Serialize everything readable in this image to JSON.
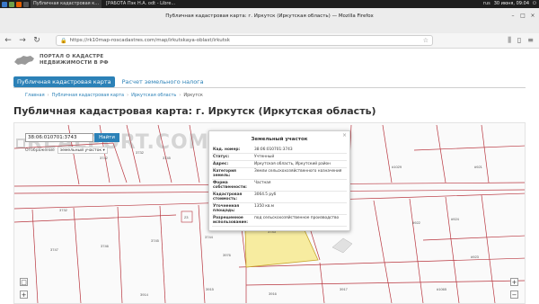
{
  "taskbar": {
    "tasks": [
      "Публичная кадастровая к...",
      "[РАБОТА Пэк Н.А. odt - Libre..."
    ],
    "clock": "30 июня, 09:04",
    "keyboard": "rus"
  },
  "browser": {
    "window_title": "Публичная кадастровая карта: г. Иркутск (Иркутская область) — Mozilla Firefox",
    "url": "https://rk10map-roscadastres.com/map/irkutskaya-oblast/irkutsk"
  },
  "site": {
    "logo_line1": "ПОРТАЛ О КАДАСТРЕ",
    "logo_line2": "НЕДВИЖИМОСТИ В РФ",
    "tabs": [
      "Публичная кадастровая карта",
      "Расчет земельного налога"
    ],
    "breadcrumb": [
      "Главная",
      "Публичная кадастровая карта",
      "Иркутская область",
      "Иркутск"
    ],
    "page_title": "Публичная кадастровая карта: г. Иркутск (Иркутская область)"
  },
  "map": {
    "search_value": "38:06:010701:3743",
    "search_button": "Найти",
    "objtype_label": "Отображение",
    "objtype_value": "земельный участок",
    "watermark": "REALPORT.COM",
    "parcel_labels": [
      "3732",
      "3732",
      "3747",
      "3746",
      "3745",
      "3744",
      "3743",
      "3917",
      "3916",
      "3915",
      "3914",
      "3976",
      "3745",
      "3742",
      "#922",
      "#923",
      "#924",
      "#921",
      "#1029",
      "#1065",
      "23"
    ],
    "zoom_in": "+",
    "zoom_out": "−",
    "zoom_box": "□"
  },
  "popup": {
    "title": "Земельный участок",
    "close": "×",
    "rows": [
      {
        "label": "Кад. номер:",
        "value": "38:06:010701:3743"
      },
      {
        "label": "Статус:",
        "value": "Учтенный"
      },
      {
        "label": "Адрес:",
        "value": "Иркутская область, Иркутский район"
      },
      {
        "label": "Категория земель:",
        "value": "Земли сельскохозяйственного назначения"
      },
      {
        "label": "Форма собственности:",
        "value": "Частная"
      },
      {
        "label": "Кадастровая стоимость:",
        "value": "3064.5 руб"
      },
      {
        "label": "Уточненная площадь:",
        "value": "1350 кв.м"
      },
      {
        "label": "Разрешенное использование:",
        "value": "под сельскохозяйственное производство"
      }
    ]
  },
  "colors": {
    "accent": "#2b81b7",
    "parcel_line": "#b8343d",
    "highlight_parcel": "#f7eca0"
  }
}
